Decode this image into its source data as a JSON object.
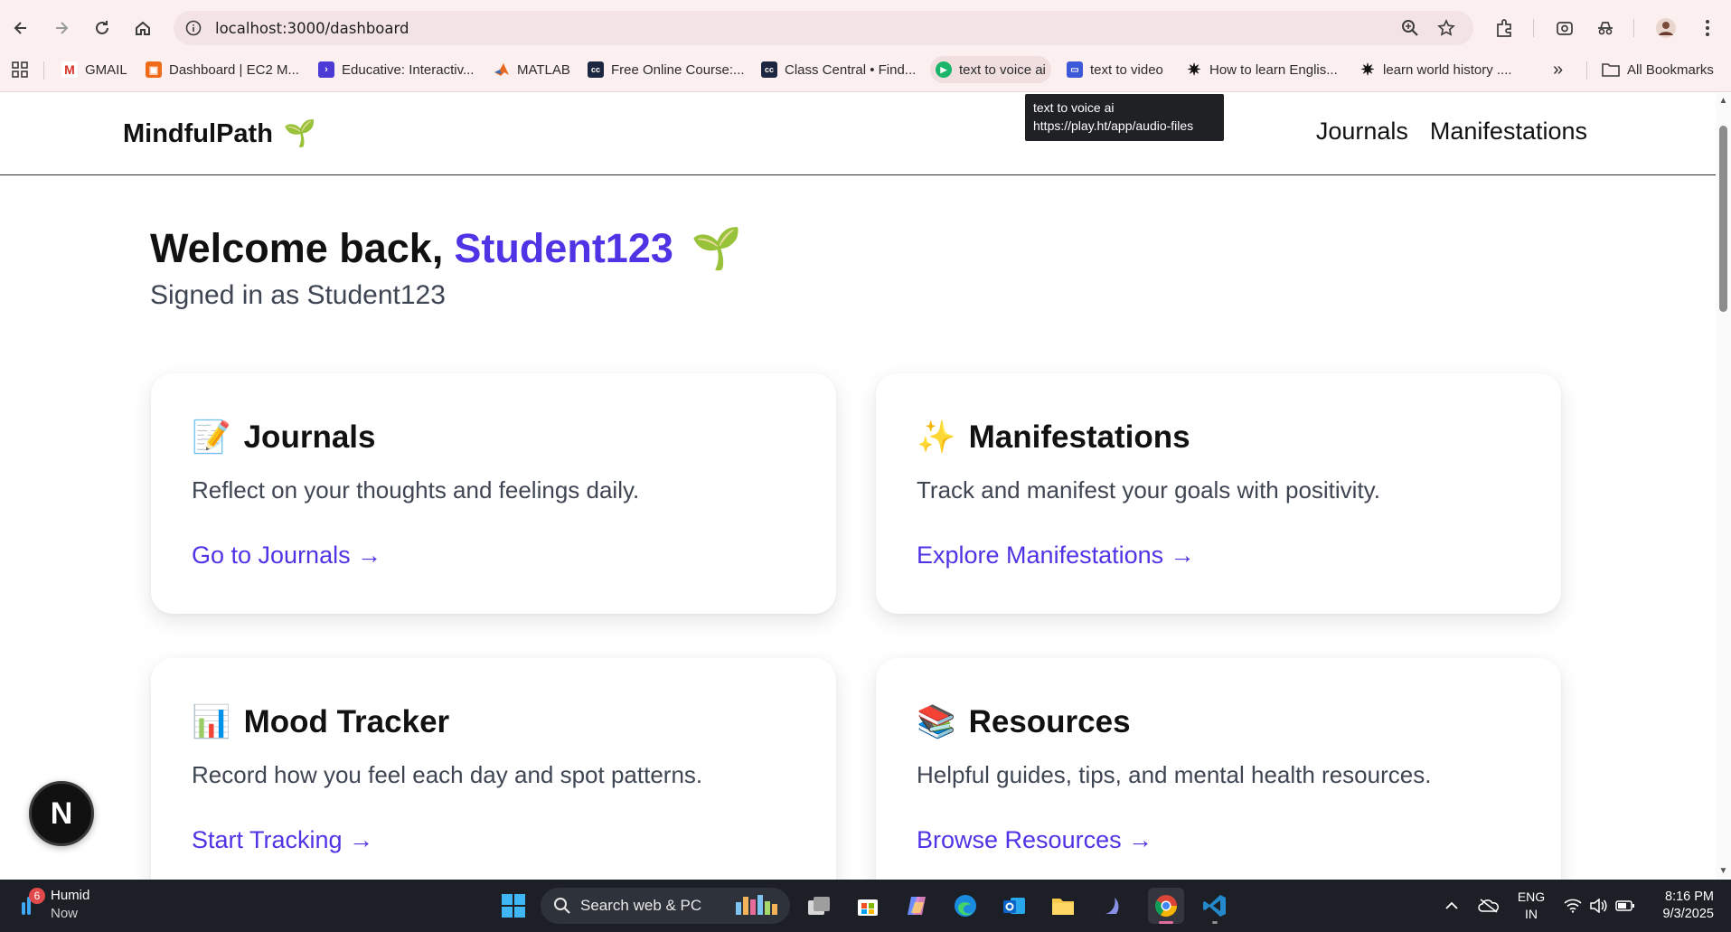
{
  "browser": {
    "url": "localhost:3000/dashboard",
    "bookmarks": [
      {
        "label": "GMAIL",
        "icon": "gmail-icon"
      },
      {
        "label": "Dashboard | EC2 M...",
        "icon": "aws-icon"
      },
      {
        "label": "Educative: Interactiv...",
        "icon": "educative-icon"
      },
      {
        "label": "MATLAB",
        "icon": "matlab-icon"
      },
      {
        "label": "Free Online Course:...",
        "icon": "classcentral-icon"
      },
      {
        "label": "Class Central • Find...",
        "icon": "classcentral-icon"
      },
      {
        "label": "text to voice ai",
        "icon": "playht-icon"
      },
      {
        "label": "text to video",
        "icon": "video-icon"
      },
      {
        "label": "How to learn Englis...",
        "icon": "star-burst-icon"
      },
      {
        "label": "learn world history ....",
        "icon": "star-burst-icon"
      }
    ],
    "all_bookmarks": "All Bookmarks",
    "overflow": "»",
    "tooltip": {
      "title": "text to voice ai",
      "url": "https://play.ht/app/audio-files"
    }
  },
  "site": {
    "brand": "MindfulPath",
    "brand_emoji": "🌱",
    "nav": [
      "Journals",
      "Manifestations"
    ]
  },
  "welcome": {
    "greeting": "Welcome back,",
    "name": "Student123",
    "emoji": "🌱",
    "signed_in": "Signed in as Student123"
  },
  "cards": [
    {
      "emoji": "📝",
      "title": "Journals",
      "desc": "Reflect on your thoughts and feelings daily.",
      "link": "Go to Journals →"
    },
    {
      "emoji": "✨",
      "title": "Manifestations",
      "desc": "Track and manifest your goals with positivity.",
      "link": "Explore Manifestations →"
    },
    {
      "emoji": "📊",
      "title": "Mood Tracker",
      "desc": "Record how you feel each day and spot patterns.",
      "link": "Start Tracking →"
    },
    {
      "emoji": "📚",
      "title": "Resources",
      "desc": "Helpful guides, tips, and mental health resources.",
      "link": "Browse Resources →"
    }
  ],
  "dev_badge": "N",
  "taskbar": {
    "weather_label": "Humid",
    "weather_sub": "Now",
    "weather_badge": "6",
    "search_placeholder": "Search web & PC",
    "lang_top": "ENG",
    "lang_bottom": "IN",
    "time": "8:16 PM",
    "date": "9/3/2025"
  },
  "colors": {
    "accent": "#4f34e6",
    "chrome_bg": "#fcefef",
    "taskbar_bg": "#1c1f26"
  }
}
